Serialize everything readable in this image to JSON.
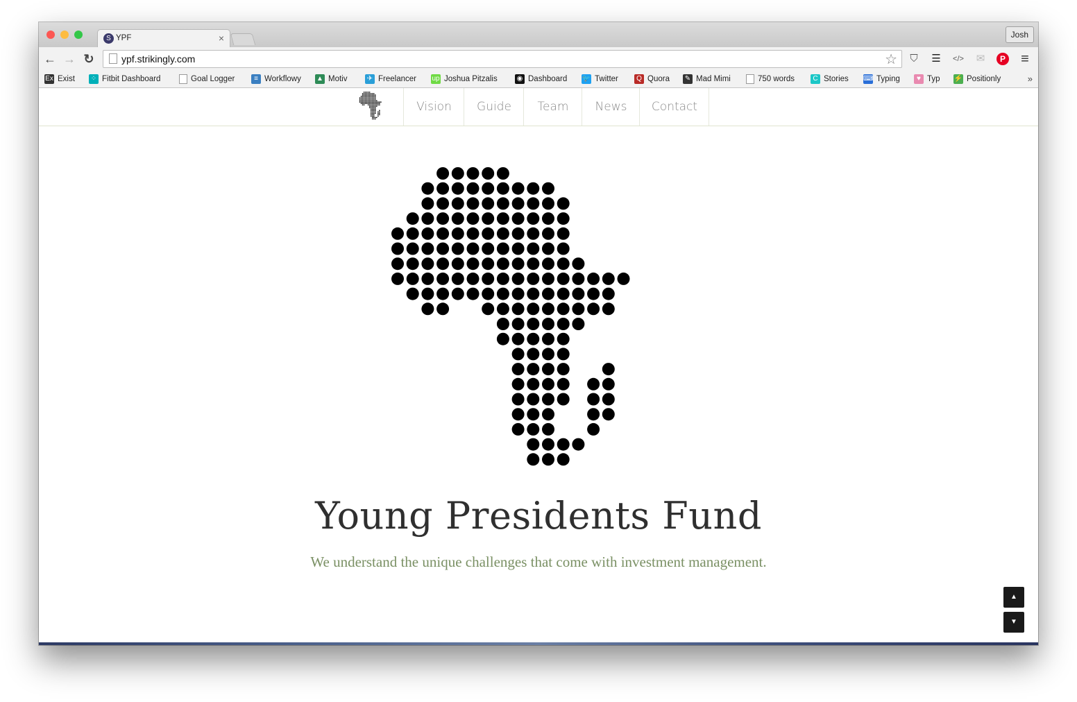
{
  "browser": {
    "tab_title": "YPF",
    "tab_favicon_letter": "S",
    "tab_close": "×",
    "url": "ypf.strikingly.com",
    "profile_name": "Josh",
    "back_glyph": "←",
    "forward_glyph": "→",
    "reload_glyph": "↻",
    "star_glyph": "☆",
    "menu_glyph": "≡",
    "colors": {
      "close": "#fc5753",
      "minimize": "#fdbc40",
      "maximize": "#33c748"
    }
  },
  "bookmarks": {
    "items": [
      {
        "label": "Exist",
        "icon": "exist-icon",
        "glyph": "Ex",
        "color": "#333333"
      },
      {
        "label": "Fitbit Dashboard",
        "icon": "fitbit-icon",
        "glyph": "⁘",
        "color": "#00b0b9"
      },
      {
        "label": "Goal Logger",
        "icon": "page-icon",
        "glyph": "",
        "color": "#ffffff"
      },
      {
        "label": "Workflowy",
        "icon": "workflowy-icon",
        "glyph": "≡",
        "color": "#3a7fc1"
      },
      {
        "label": "Motiv",
        "icon": "motiv-icon",
        "glyph": "▲",
        "color": "#2e8b57"
      },
      {
        "label": "Freelancer",
        "icon": "freelancer-icon",
        "glyph": "✈",
        "color": "#2a9fd8"
      },
      {
        "label": "Joshua Pitzalis",
        "icon": "upwork-icon",
        "glyph": "up",
        "color": "#6fda44"
      },
      {
        "label": "Dashboard",
        "icon": "target-icon",
        "glyph": "◉",
        "color": "#111111"
      },
      {
        "label": "Twitter",
        "icon": "twitter-icon",
        "glyph": "🐦",
        "color": "#1da1f2"
      },
      {
        "label": "Quora",
        "icon": "quora-icon",
        "glyph": "Q",
        "color": "#b92b27"
      },
      {
        "label": "Mad Mimi",
        "icon": "madmimi-icon",
        "glyph": "✎",
        "color": "#333333"
      },
      {
        "label": "750 words",
        "icon": "page-icon",
        "glyph": "",
        "color": "#ffffff"
      },
      {
        "label": "Stories",
        "icon": "stories-icon",
        "glyph": "C",
        "color": "#1cc7c7"
      },
      {
        "label": "Typing",
        "icon": "typing-icon",
        "glyph": "⌨",
        "color": "#2a6fd8"
      },
      {
        "label": "Typ",
        "icon": "typ-icon",
        "glyph": "♥",
        "color": "#e98ab0"
      },
      {
        "label": "Positionly",
        "icon": "positionly-icon",
        "glyph": "⚡",
        "color": "#4caf50"
      }
    ],
    "more": "»"
  },
  "site": {
    "nav": [
      {
        "label": "Vision"
      },
      {
        "label": "Guide"
      },
      {
        "label": "Team"
      },
      {
        "label": "News"
      },
      {
        "label": "Contact"
      }
    ],
    "title": "Young Presidents Fund",
    "subtitle": "We understand the unique challenges that come with investment management.",
    "scroll_up": "▲",
    "scroll_down": "▼"
  },
  "colors": {
    "title": "#2f2f2f",
    "subtitle": "#7a9064",
    "nav_text": "#8a8a8a",
    "dot": "#000000"
  }
}
